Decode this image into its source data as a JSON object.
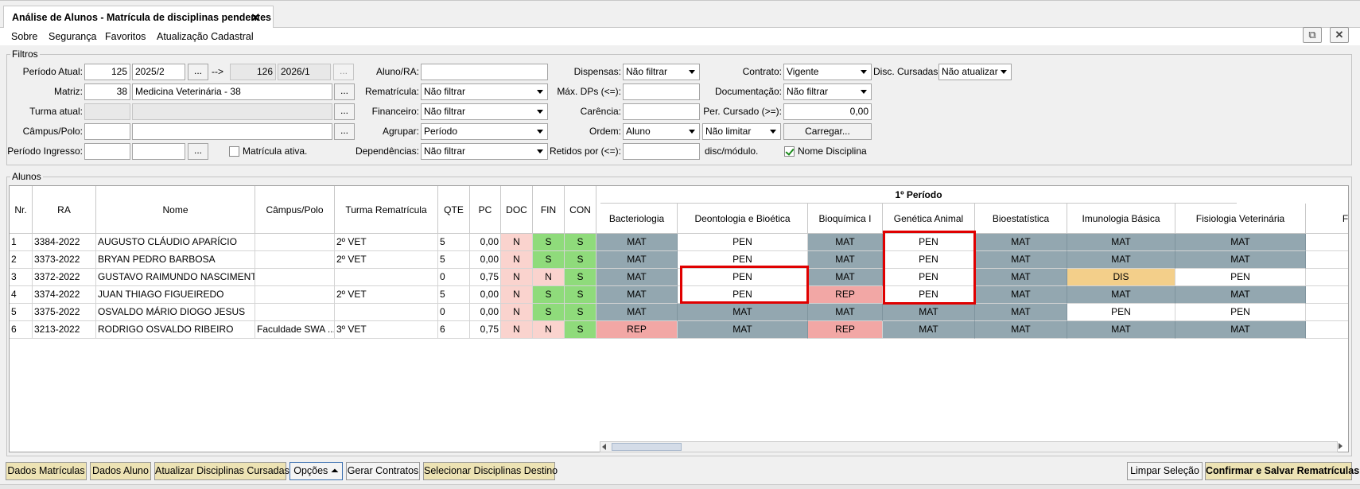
{
  "tab": {
    "title": "Análise de Alunos - Matrícula de disciplinas pendentes",
    "close": "✕"
  },
  "menu": [
    "Sobre",
    "Segurança",
    "Favoritos",
    "Atualização Cadastral"
  ],
  "window_buttons": {
    "popout": "⧉",
    "close": "✕"
  },
  "filtros": {
    "title": "Filtros",
    "periodo_atual": {
      "label": "Período Atual:",
      "code": "125",
      "value": "2025/2",
      "dots": "...",
      "arrow": "-->",
      "dest_code": "126",
      "dest_value": "2026/1",
      "dest_dots": "..."
    },
    "matriz": {
      "label": "Matriz:",
      "code": "38",
      "value": "Medicina Veterinária - 38",
      "dots": "..."
    },
    "turma_atual": {
      "label": "Turma atual:",
      "dots": "..."
    },
    "campus_polo": {
      "label": "Câmpus/Polo:",
      "dots": "..."
    },
    "periodo_ingresso": {
      "label": "Período Ingresso:",
      "dots": "..."
    },
    "matricula_ativa": {
      "label": "Matrícula ativa.",
      "checked": false
    },
    "aluno_ra": {
      "label": "Aluno/RA:",
      "value": ""
    },
    "rematricula": {
      "label": "Rematrícula:",
      "value": "Não filtrar"
    },
    "financeiro": {
      "label": "Financeiro:",
      "value": "Não filtrar"
    },
    "agrupar": {
      "label": "Agrupar:",
      "value": "Período"
    },
    "dependencias": {
      "label": "Dependências:",
      "value": "Não filtrar"
    },
    "dispensas": {
      "label": "Dispensas:",
      "value": "Não filtrar"
    },
    "max_dps": {
      "label": "Máx. DPs (<=):",
      "value": ""
    },
    "carencia": {
      "label": "Carência:",
      "value": ""
    },
    "ordem": {
      "label": "Ordem:",
      "value": "Aluno",
      "limit": "Não limitar"
    },
    "retidos": {
      "label": "Retidos por (<=):",
      "value": "",
      "suffix": "disc/módulo."
    },
    "contrato": {
      "label": "Contrato:",
      "value": "Vigente"
    },
    "documentacao": {
      "label": "Documentação:",
      "value": "Não filtrar"
    },
    "per_cursado": {
      "label": "Per. Cursado (>=):",
      "value": "0,00"
    },
    "carregar": "Carregar...",
    "nome_disciplina": {
      "label": "Nome Disciplina",
      "checked": true
    },
    "disc_cursadas": {
      "label": "Disc. Cursadas:",
      "value": "Não atualizar"
    }
  },
  "alunos": {
    "title": "Alunos",
    "period_header": "1º Período",
    "columns": [
      "Nr.",
      "RA",
      "Nome",
      "Câmpus/Polo",
      "Turma Rematrícula",
      "QTE",
      "PC",
      "DOC",
      "FIN",
      "CON"
    ],
    "subjects": [
      "Bacteriologia",
      "Deontologia e Bioética",
      "Bioquímica I",
      "Genética Animal",
      "Bioestatística",
      "Imunologia Básica",
      "Fisiologia Veterinária",
      "Fund"
    ],
    "rows": [
      {
        "nr": "1",
        "ra": "3384-2022",
        "nome": "AUGUSTO CLÁUDIO APARÍCIO",
        "campus": "",
        "turma": "2º VET",
        "qte": "5",
        "pc": "0,00",
        "doc": "N",
        "fin": "S",
        "con": "S",
        "subj": [
          "MAT",
          "PEN",
          "MAT",
          "PEN",
          "MAT",
          "MAT",
          "MAT",
          ""
        ]
      },
      {
        "nr": "2",
        "ra": "3373-2022",
        "nome": "BRYAN PEDRO BARBOSA",
        "campus": "",
        "turma": "2º VET",
        "qte": "5",
        "pc": "0,00",
        "doc": "N",
        "fin": "S",
        "con": "S",
        "subj": [
          "MAT",
          "PEN",
          "MAT",
          "PEN",
          "MAT",
          "MAT",
          "MAT",
          ""
        ]
      },
      {
        "nr": "3",
        "ra": "3372-2022",
        "nome": "GUSTAVO RAIMUNDO NASCIMENTO",
        "campus": "",
        "turma": "",
        "qte": "0",
        "pc": "0,75",
        "doc": "N",
        "fin": "N",
        "con": "S",
        "subj": [
          "MAT",
          "PEN",
          "MAT",
          "PEN",
          "MAT",
          "DIS",
          "PEN",
          ""
        ]
      },
      {
        "nr": "4",
        "ra": "3374-2022",
        "nome": "JUAN THIAGO FIGUEIREDO",
        "campus": "",
        "turma": "2º VET",
        "qte": "5",
        "pc": "0,00",
        "doc": "N",
        "fin": "S",
        "con": "S",
        "subj": [
          "MAT",
          "PEN",
          "REP",
          "PEN",
          "MAT",
          "MAT",
          "MAT",
          ""
        ]
      },
      {
        "nr": "5",
        "ra": "3375-2022",
        "nome": "OSVALDO MÁRIO DIOGO JESUS",
        "campus": "",
        "turma": "",
        "qte": "0",
        "pc": "0,00",
        "doc": "N",
        "fin": "S",
        "con": "S",
        "subj": [
          "MAT",
          "MAT",
          "MAT",
          "MAT",
          "MAT",
          "PEN",
          "PEN",
          ""
        ]
      },
      {
        "nr": "6",
        "ra": "3213-2022",
        "nome": "RODRIGO OSVALDO RIBEIRO",
        "campus": "Faculdade SWA ...",
        "turma": "3º VET",
        "qte": "6",
        "pc": "0,75",
        "doc": "N",
        "fin": "N",
        "con": "S",
        "subj": [
          "REP",
          "MAT",
          "REP",
          "MAT",
          "MAT",
          "MAT",
          "MAT",
          ""
        ]
      }
    ]
  },
  "status_colors": {
    "MAT": "#93a7b0",
    "PEN": "#ffffff",
    "REP": "#f2a7a5",
    "DIS": "#f3cf8a",
    "S": "#8fdb7b",
    "N_light": "#fad3ce"
  },
  "bottom_buttons": {
    "dados_matriculas": "Dados Matrículas",
    "dados_aluno": "Dados Aluno",
    "atualizar_disciplinas": "Atualizar Disciplinas Cursadas",
    "opcoes": "Opções ⏶",
    "gerar_contratos": "Gerar Contratos",
    "selecionar_disciplinas": "Selecionar Disciplinas Destino",
    "limpar_selecao": "Limpar Seleção",
    "confirmar_salvar": "Confirmar e Salvar Rematrículas"
  }
}
